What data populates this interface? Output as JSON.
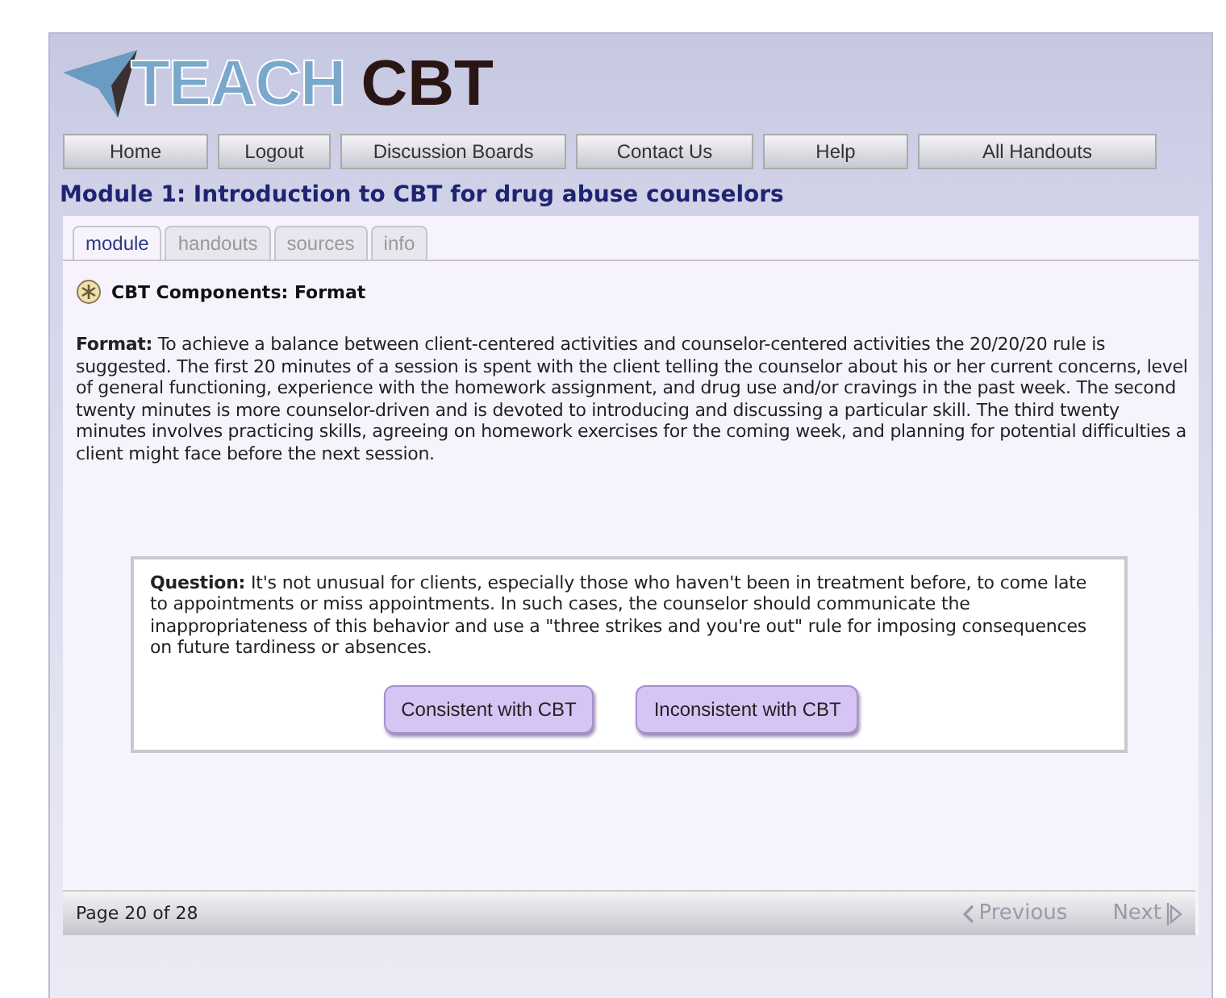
{
  "logo": {
    "part_1": "TEACH",
    "part_2": "CBT"
  },
  "nav": [
    "Home",
    "Logout",
    "Discussion Boards",
    "Contact Us",
    "Help",
    "All Handouts"
  ],
  "module_title": "Module 1: Introduction to CBT for drug abuse counselors",
  "tabs": [
    {
      "label": "module",
      "selected": true
    },
    {
      "label": "handouts",
      "selected": false
    },
    {
      "label": "sources",
      "selected": false
    },
    {
      "label": "info",
      "selected": false
    }
  ],
  "section_title": "CBT Components: Format",
  "body": "**Format:** To achieve a balance between client-centered activities and counselor-centered activities the 20/20/20 rule is suggested. The first 20 minutes of a session is spent with the client telling the counselor about his or her current concerns, level of general functioning, experience with the homework assignment, and drug use and/or cravings in the past week. The second twenty minutes is more counselor-driven and is devoted to introducing and discussing a particular skill. The third twenty minutes involves practicing skills, agreeing on homework exercises for the coming week, and planning for potential difficulties a client might face before the next session.",
  "question": {
    "text": "**Question:** It's not unusual for clients, especially those who haven't been in treatment before, to come late to appointments or miss appointments. In such cases, the counselor should communicate the inappropriateness of this behavior and use a \"three strikes and you're out\" rule for imposing consequences on future tardiness or absences.",
    "answers": [
      "Consistent with CBT",
      "Inconsistent with CBT"
    ]
  },
  "footer": {
    "page": "Page 20 of 28",
    "previous": {
      "label": "Previous",
      "disabled": true
    },
    "next": {
      "label": "Next",
      "disabled": true
    }
  }
}
